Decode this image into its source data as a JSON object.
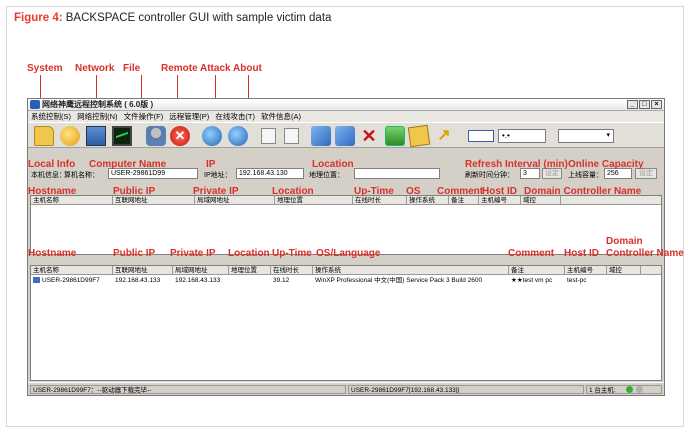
{
  "caption": {
    "prefix": "Figure 4:",
    "text": " BACKSPACE controller GUI with sample victim data"
  },
  "annotations_top": {
    "system": "System",
    "network": "Network",
    "file": "File",
    "remote": "Remote",
    "attack": "Attack",
    "about": "About"
  },
  "annotations_info": {
    "local_info": "Local Info",
    "computer_name": "Computer Name",
    "ip": "IP",
    "location": "Location",
    "refresh_interval": "Refresh Interval (min)",
    "online_capacity": "Online Capacity"
  },
  "annotations_list1": {
    "hostname": "Hostname",
    "public_ip": "Public IP",
    "private_ip": "Private IP",
    "location": "Location",
    "up_time": "Up-Time",
    "os": "OS",
    "comment": "Comment",
    "host_id": "Host ID",
    "domain_controller_name": "Domain Controller Name"
  },
  "annotations_list2": {
    "hostname": "Hostname",
    "public_ip": "Public IP",
    "private_ip": "Private IP",
    "location": "Location",
    "up_time": "Up-Time",
    "os_language": "OS/Language",
    "comment": "Comment",
    "host_id": "Host ID",
    "domain_line1": "Domain",
    "domain_line2": "Controller Name"
  },
  "window": {
    "title": "网络神鹰远程控制系统 ( 6.0版 )",
    "min": "_",
    "max": "□",
    "close": "×",
    "menu": [
      "系统控制(S)",
      "网络控制(N)",
      "文件操作(F)",
      "远程管理(P)",
      "在线攻击(T)",
      "软件信息(A)"
    ],
    "combo1_value": "•.•",
    "combo2_value": "▾"
  },
  "info": {
    "local_label": "本机信息：",
    "computer_label": "算机名称：",
    "computer_value": "USER-29861D99",
    "ip_label": "IP地址：",
    "ip_value": "192.168.43.130",
    "location_label": "地理位置：",
    "location_value": "",
    "refresh_label": "刷新时间分钟：",
    "refresh_value": "3",
    "set1": "设定",
    "capacity_label": "上线容量：",
    "capacity_value": "256",
    "set2": "设定"
  },
  "list1_headers": [
    "主机名称",
    "互联网地址",
    "局域网地址",
    "地理位置",
    "在线时长",
    "操作系统",
    "备注",
    "主机编号",
    "域控"
  ],
  "list2_headers": [
    "主机名称",
    "互联网地址",
    "局域网地址",
    "地理位置",
    "在线时长",
    "操作系统",
    "备注",
    "主机编号",
    "域控"
  ],
  "victim_row": {
    "hostname": "USER-29861D99F7",
    "public_ip": "192.168.43.133",
    "private_ip": "192.168.43.133",
    "location": "",
    "up_time": "39.12",
    "os": "WinXP Professional 中文(中国) Service Pack 3 Build 2600",
    "comment": "★★test vm pc",
    "host_id": "test-pc",
    "dc": ""
  },
  "status": {
    "left": "USER-29861D99F7：--驱动器下载完毕--",
    "middle": "USER-29861D99F7[192.168.43.133]|",
    "right": "1 台主机:"
  },
  "colors": {
    "annotation": "#d9302a",
    "figure_label": "#e8392f"
  }
}
